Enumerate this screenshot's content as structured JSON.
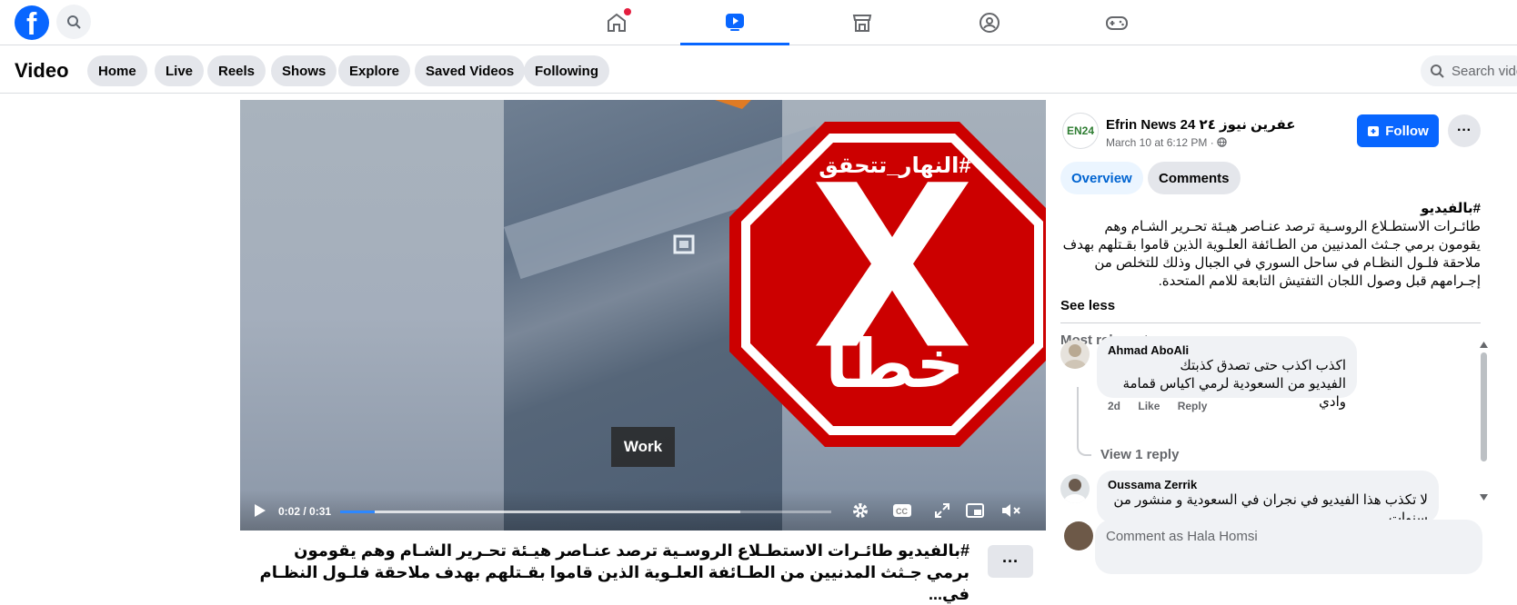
{
  "topbar": {
    "logo_letter": "f",
    "nav": [
      {
        "name": "home",
        "active": false,
        "badge": true
      },
      {
        "name": "video",
        "active": true,
        "badge": false
      },
      {
        "name": "marketplace",
        "active": false,
        "badge": false
      },
      {
        "name": "groups",
        "active": false,
        "badge": false
      },
      {
        "name": "gaming",
        "active": false,
        "badge": false
      }
    ],
    "accent": "#0866ff"
  },
  "subbar": {
    "title": "Video",
    "pills": [
      "Home",
      "Live",
      "Reels",
      "Shows",
      "Explore",
      "Saved Videos",
      "Following"
    ],
    "search_placeholder": "Search vide"
  },
  "player": {
    "time": "0:02 / 0:31",
    "progress": 0.07,
    "tooltip": "Work",
    "overlay_hashtag": "#النهار_تتحقق",
    "overlay_word": "خطأ",
    "overlay_color": "#cc0000"
  },
  "caption": {
    "text": "#بالفيديو طائـرات الاستطـلاع الروسـية ترصد عنـاصر هيـئة تحـرير الشـام وهم يقومون برمي جـثث المدنيين من الطـائفة العلـوية الذين قاموا بقـتلهم بهدف ملاحقة فلـول النظـام في...",
    "more": "···"
  },
  "post": {
    "page_name": "Efrin News 24 عفرين نيوز ٢٤",
    "avatar_text": "EN24",
    "date": "March 10 at 6:12 PM · ",
    "follow": "Follow",
    "more": "···",
    "tabs": {
      "overview": "Overview",
      "comments": "Comments"
    },
    "hashtag": "#بالفيديو",
    "body": "طائـرات الاستطـلاع الروسـية ترصد عنـاصر هيـئة تحـرير الشـام وهم يقومون برمي جـثث المدنيين من الطـائفة العلـوية الذين قاموا بقـتلهم بهدف ملاحقة فلـول النظـام في ساحل السوري في الجبال وذلك للتخلص من إجـرامهم قبل وصول اللجان التفتيش التابعة للامم المتحدة.",
    "see_less": "See less",
    "sort": "Most relevant"
  },
  "comments": [
    {
      "name": "Ahmad AboAli",
      "line1": "اكذب اكذب حتى تصدق كذبتك",
      "line2": "الفيديو من السعودية لرمي اكياس قمامة وادي",
      "age": "2d",
      "like": "Like",
      "reply": "Reply",
      "view_replies": "View 1 reply"
    },
    {
      "name": "Oussama Zerrik",
      "line1": "لا تكذب هذا الفيديو في نجران في السعودية و منشور من",
      "line2": "سنوات ."
    }
  ],
  "composer": {
    "placeholder": "Comment as Hala Homsi"
  }
}
